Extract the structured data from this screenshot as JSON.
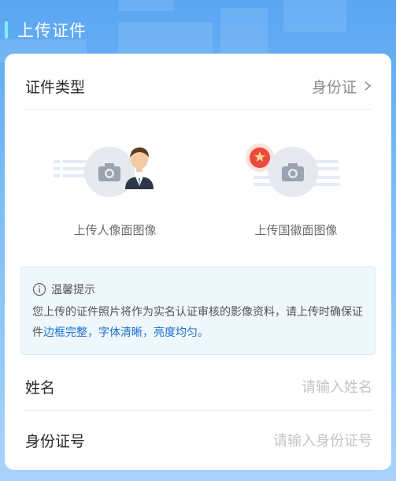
{
  "header": {
    "title": "上传证件"
  },
  "cert_type": {
    "label": "证件类型",
    "value": "身份证"
  },
  "uploads": {
    "portrait": {
      "caption": "上传人像面图像"
    },
    "emblem": {
      "caption": "上传国徽面图像"
    }
  },
  "tip": {
    "title": "温馨提示",
    "body_plain": "您上传的证件照片将作为实名认证审核的影像资料，请上传时确保证件",
    "body_highlight": "边框完整，字体清晰，亮度均匀。"
  },
  "fields": {
    "name": {
      "label": "姓名",
      "placeholder": "请输入姓名"
    },
    "id_number": {
      "label": "身份证号",
      "placeholder": "请输入身份证号"
    }
  },
  "colors": {
    "accent": "#1a6fd0",
    "header_bg": "#5aa6f2",
    "tip_bg": "#eef7fc"
  }
}
